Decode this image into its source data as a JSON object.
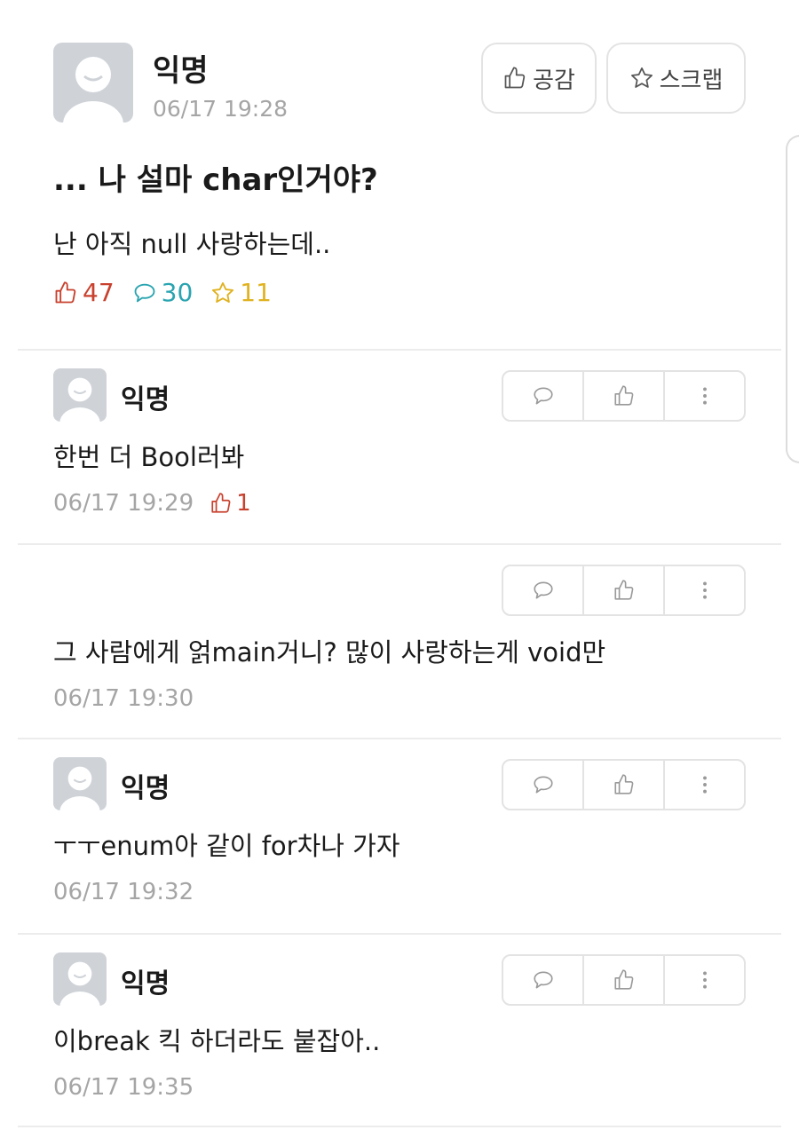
{
  "post": {
    "author": "익명",
    "time": "06/17 19:28",
    "like_button_label": "공감",
    "scrap_button_label": "스크랩",
    "title": "... 나 설마 char인거야?",
    "body": "난 아직 null 사랑하는데..",
    "stats": {
      "likes": "47",
      "comments": "30",
      "scraps": "11"
    }
  },
  "comments": [
    {
      "author": "익명",
      "text": "한번 더 Bool러봐",
      "time": "06/17 19:29",
      "likes": "1"
    },
    {
      "author": "",
      "text": "그 사람에게 얽main거니? 많이 사랑하는게 void만",
      "time": "06/17 19:30"
    },
    {
      "author": "익명",
      "text": "ㅜㅜenum아 같이 for차나 가자",
      "time": "06/17 19:32"
    },
    {
      "author": "익명",
      "text": "이break 킥 하더라도 붙잡아..",
      "time": "06/17 19:35"
    }
  ],
  "colors": {
    "like": "#c8412e",
    "comment": "#2aa4b0",
    "scrap": "#e0b220",
    "muted": "#a5a5a5",
    "avatar": "#cfd3d8"
  },
  "icons": [
    "thumbs-up-icon",
    "star-icon",
    "speech-bubble-icon",
    "more-dots-icon",
    "avatar-icon"
  ]
}
